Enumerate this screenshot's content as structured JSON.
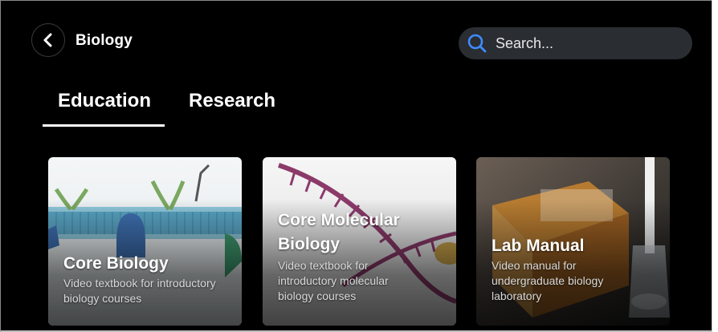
{
  "header": {
    "title": "Biology",
    "back_icon": "chevron-left-icon",
    "search": {
      "placeholder": "Search...",
      "value": "",
      "icon": "search-icon"
    }
  },
  "tabs": [
    {
      "label": "Education",
      "active": true
    },
    {
      "label": "Research",
      "active": false
    }
  ],
  "cards": [
    {
      "title": "Core Biology",
      "description": "Video textbook for introductory biology courses"
    },
    {
      "title": "Core Molecular Biology",
      "description": "Video textbook for introductory molecular biology courses"
    },
    {
      "title": "Lab Manual",
      "description": "Video manual for undergraduate biology laboratory"
    }
  ],
  "colors": {
    "background": "#000000",
    "search_bg": "#2a2d31",
    "search_icon": "#3d8bff",
    "text": "#ffffff"
  }
}
